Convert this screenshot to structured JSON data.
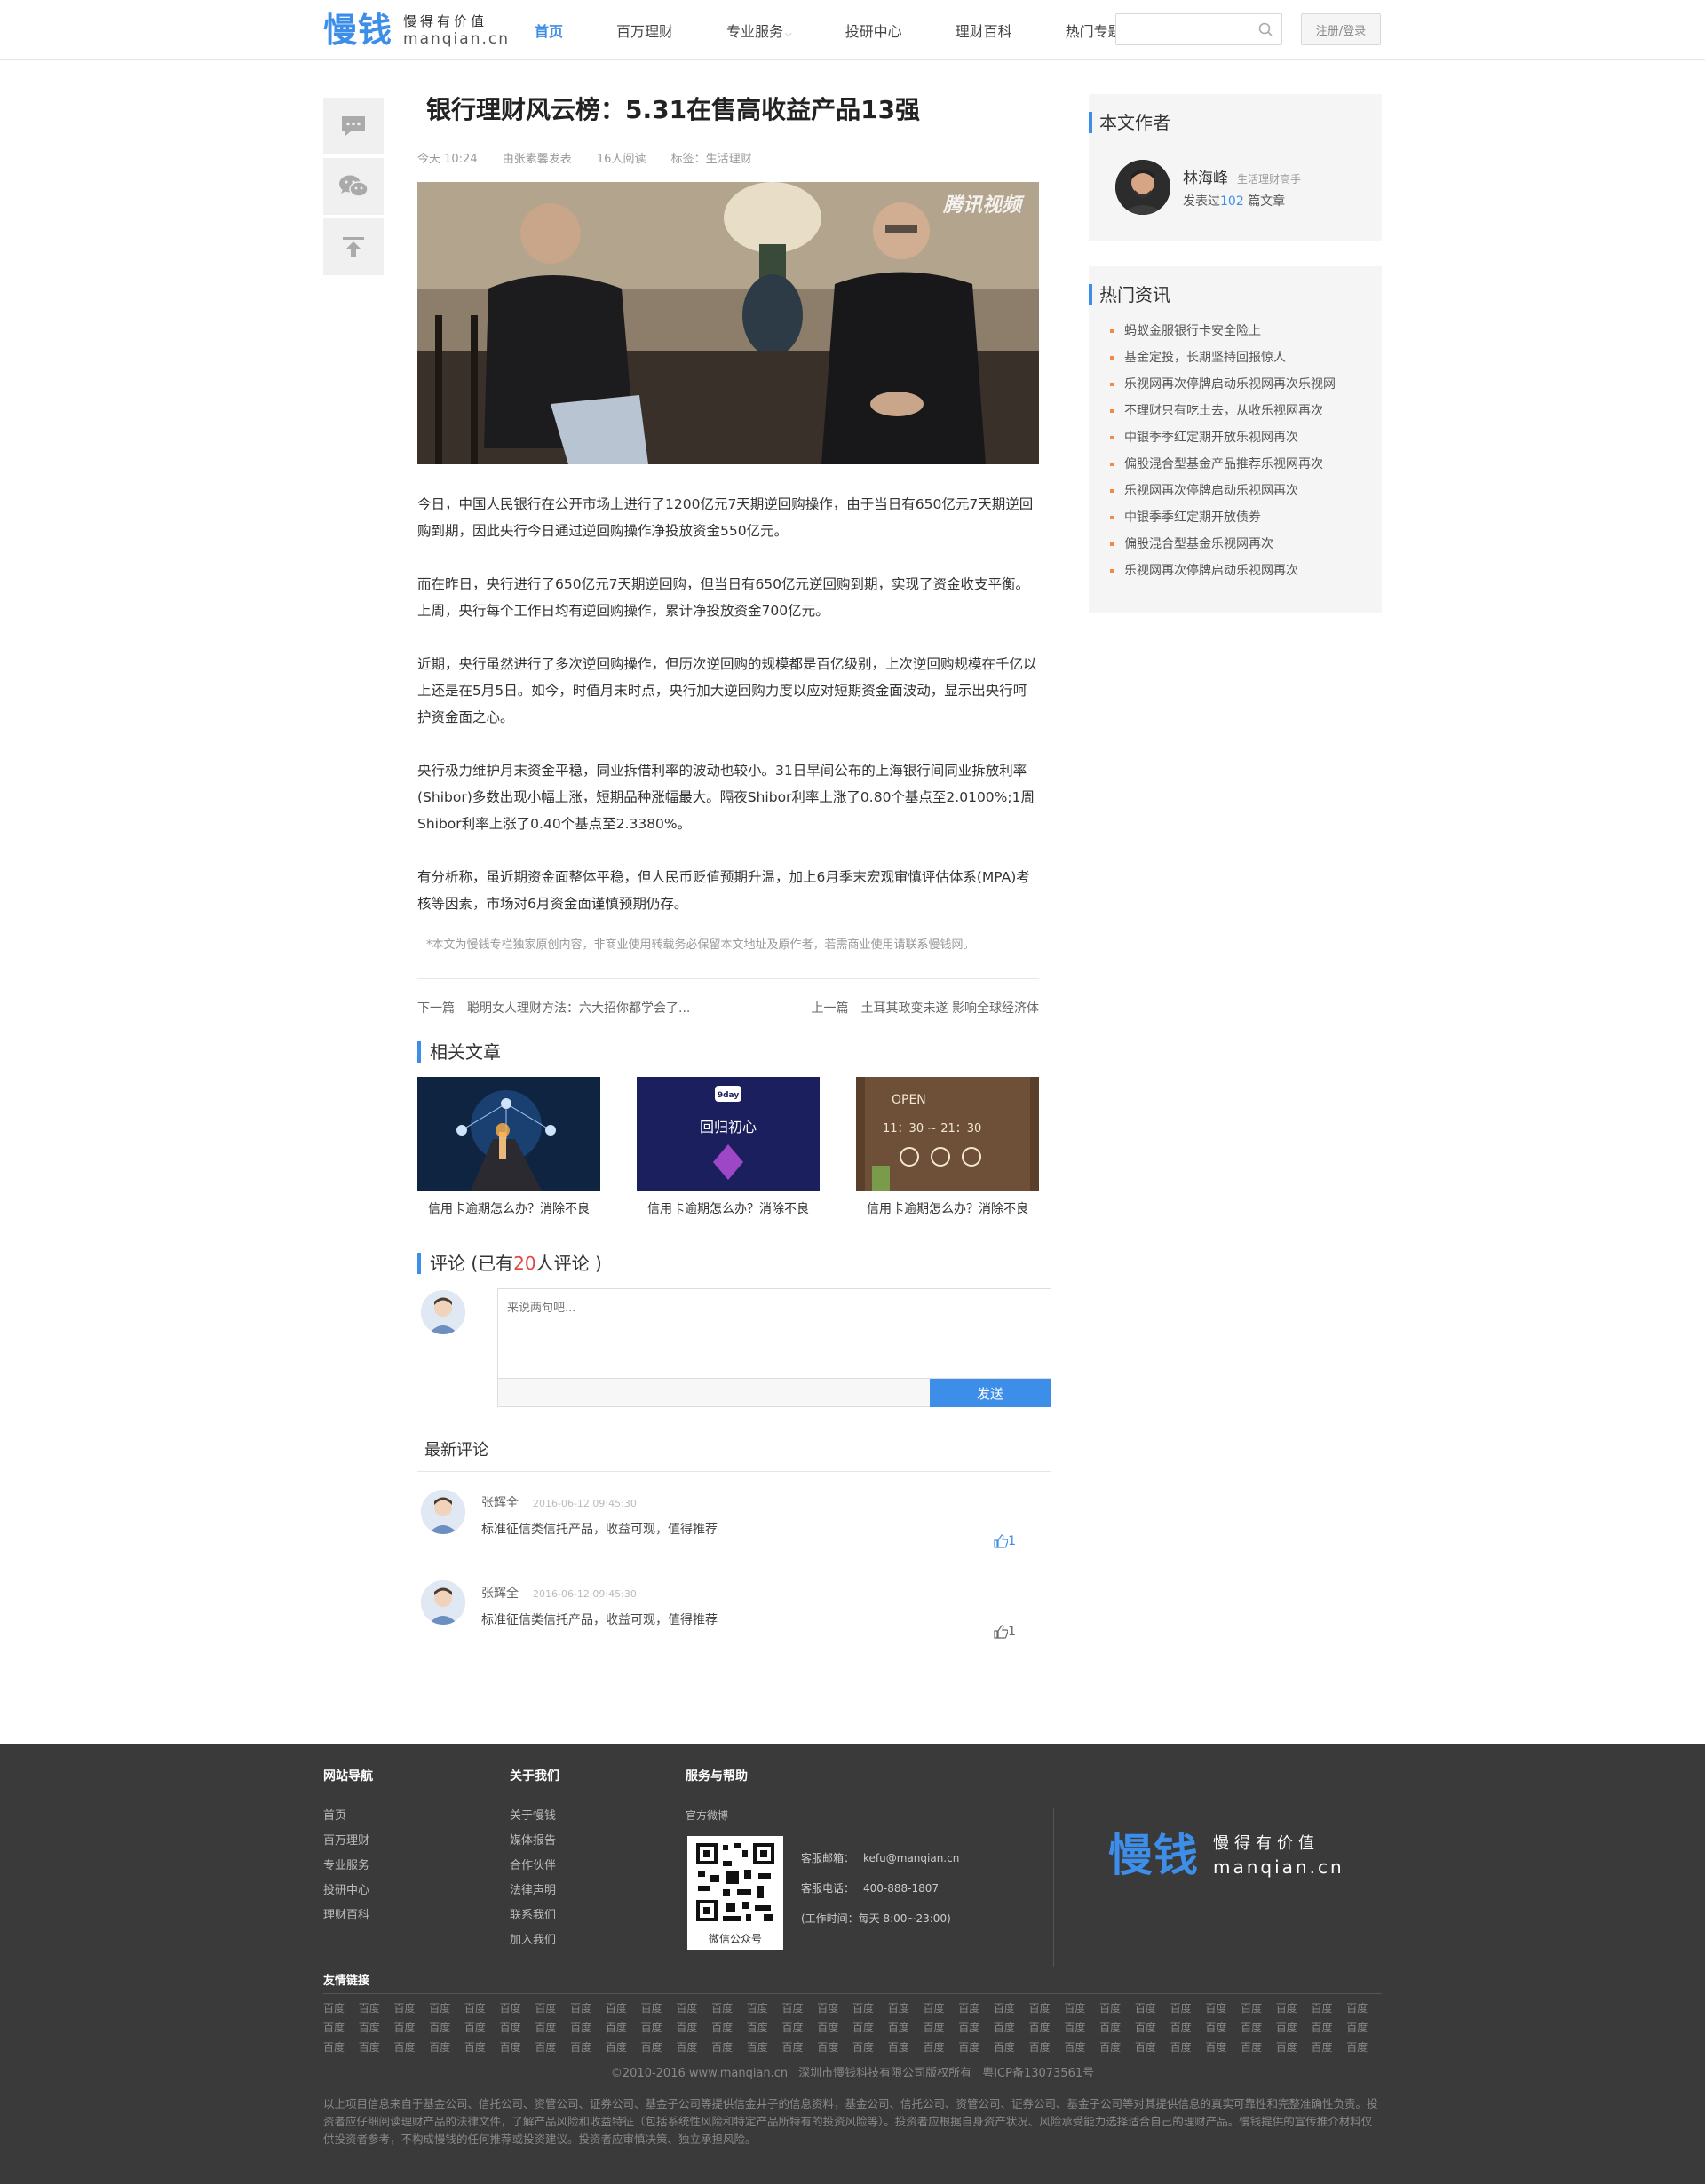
{
  "header": {
    "logo_mark": "慢钱",
    "logo_slogan": "慢得有价值",
    "logo_domain": "manqian.cn",
    "nav": [
      "首页",
      "百万理财",
      "专业服务",
      "投研中心",
      "理财百科",
      "热门专题"
    ],
    "search_placeholder": "",
    "login_label": "注册/登录",
    "accent_color": "#3d8ee8"
  },
  "share_icons": [
    "comment-icon",
    "wechat-icon",
    "back-to-top-icon"
  ],
  "article": {
    "title": "银行理财风云榜：5.31在售高收益产品13强",
    "meta_time": "今天 10:24",
    "meta_author": "由张素馨发表",
    "meta_views": "16人阅读",
    "meta_tags": "标签：生活理财",
    "hero_watermark": "腾讯视频",
    "paragraphs": [
      "今日，中国人民银行在公开市场上进行了1200亿元7天期逆回购操作，由于当日有650亿元7天期逆回购到期，因此央行今日通过逆回购操作净投放资金550亿元。",
      "而在昨日，央行进行了650亿元7天期逆回购，但当日有650亿元逆回购到期，实现了资金收支平衡。上周，央行每个工作日均有逆回购操作，累计净投放资金700亿元。",
      "近期，央行虽然进行了多次逆回购操作，但历次逆回购的规模都是百亿级别，上次逆回购规模在千亿以上还是在5月5日。如今，时值月末时点，央行加大逆回购力度以应对短期资金面波动，显示出央行呵护资金面之心。",
      "央行极力维护月末资金平稳，同业拆借利率的波动也较小。31日早间公布的上海银行间同业拆放利率(Shibor)多数出现小幅上涨，短期品种涨幅最大。隔夜Shibor利率上涨了0.80个基点至2.0100%;1周Shibor利率上涨了0.40个基点至2.3380%。",
      "有分析称，虽近期资金面整体平稳，但人民币贬值预期升温，加上6月季末宏观审慎评估体系(MPA)考核等因素，市场对6月资金面谨慎预期仍存。"
    ],
    "copyright_note": "*本文为慢钱专栏独家原创内容，非商业使用转载务必保留本文地址及原作者，若需商业使用请联系慢钱网。",
    "next_label": "下一篇",
    "next_title": "聪明女人理财方法：六大招你都学会了...",
    "prev_label": "上一篇",
    "prev_title": "土耳其政变未遂 影响全球经济体"
  },
  "related": {
    "title": "相关文章",
    "items": [
      {
        "caption": "信用卡逾期怎么办？消除不良"
      },
      {
        "caption": "信用卡逾期怎么办？消除不良",
        "img_text_1": "9day",
        "img_text_2": "回归初心"
      },
      {
        "caption": "信用卡逾期怎么办？消除不良",
        "img_text_1": "OPEN",
        "img_text_2": "11：30 ~ 21：30"
      }
    ]
  },
  "comments": {
    "title_prefix": "评论 (已有",
    "count": "20",
    "title_suffix": "人评论 )",
    "placeholder": "来说两句吧...",
    "send_label": "发送",
    "latest_title": "最新评论",
    "items": [
      {
        "user": "张辉全",
        "time": "2016-06-12 09:45:30",
        "text": "标准征信类信托产品，收益可观，值得推荐",
        "likes": "1"
      },
      {
        "user": "张辉全",
        "time": "2016-06-12 09:45:30",
        "text": "标准征信类信托产品，收益可观，值得推荐",
        "likes": "1"
      }
    ]
  },
  "author_card": {
    "title": "本文作者",
    "name": "林海峰",
    "tag": "生活理财高手",
    "posts_prefix": "发表过",
    "posts_count": "102",
    "posts_suffix": "篇文章"
  },
  "hot": {
    "title": "热门资讯",
    "items": [
      "蚂蚁金服银行卡安全险上",
      "基金定投，长期坚持回报惊人",
      "乐视网再次停牌启动乐视网再次乐视网",
      "不理财只有吃土去，从收乐视网再次",
      "中银季季红定期开放乐视网再次",
      "偏股混合型基金产品推荐乐视网再次",
      "乐视网再次停牌启动乐视网再次",
      "中银季季红定期开放债券",
      "偏股混合型基金乐视网再次",
      "乐视网再次停牌启动乐视网再次"
    ]
  },
  "footer": {
    "nav_title": "网站导航",
    "nav_links": [
      "首页",
      "百万理财",
      "专业服务",
      "投研中心",
      "理财百科"
    ],
    "about_title": "关于我们",
    "about_links": [
      "关于慢钱",
      "媒体报告",
      "合作伙伴",
      "法律声明",
      "联系我们",
      "加入我们"
    ],
    "service_title": "服务与帮助",
    "service_sub": "官方微博",
    "qr_label": "微信公众号",
    "email_label": "客服邮箱：",
    "email": "kefu@manqian.cn",
    "phone_label": "客服电话：",
    "phone": "400-888-1807",
    "hours": "(工作时间：每天 8:00~23:00)",
    "friends_title": "友情链接",
    "friend_link": "百度",
    "copyright_1": "©2010-2016 www.manqian.cn",
    "copyright_2": "深圳市慢钱科技有限公司版权所有",
    "copyright_3": "粤ICP备13073561号",
    "disclaimer": "以上项目信息来自于基金公司、信托公司、资管公司、证券公司、基金子公司等提供信金井子的信息资料，基金公司、信托公司、资管公司、证券公司、基金子公司等对其提供信息的真实可靠性和完整准确性负责。投资者应仔细阅读理财产品的法律文件，了解产品风险和收益特征（包括系统性风险和特定产品所特有的投资风险等）。投资者应根据自身资产状况、风险承受能力选择适合自己的理财产品。慢钱提供的宣传推介材料仅供投资者参考，不构成慢钱的任何推荐或投资建议。投资者应审慎决策、独立承担风险。"
  }
}
